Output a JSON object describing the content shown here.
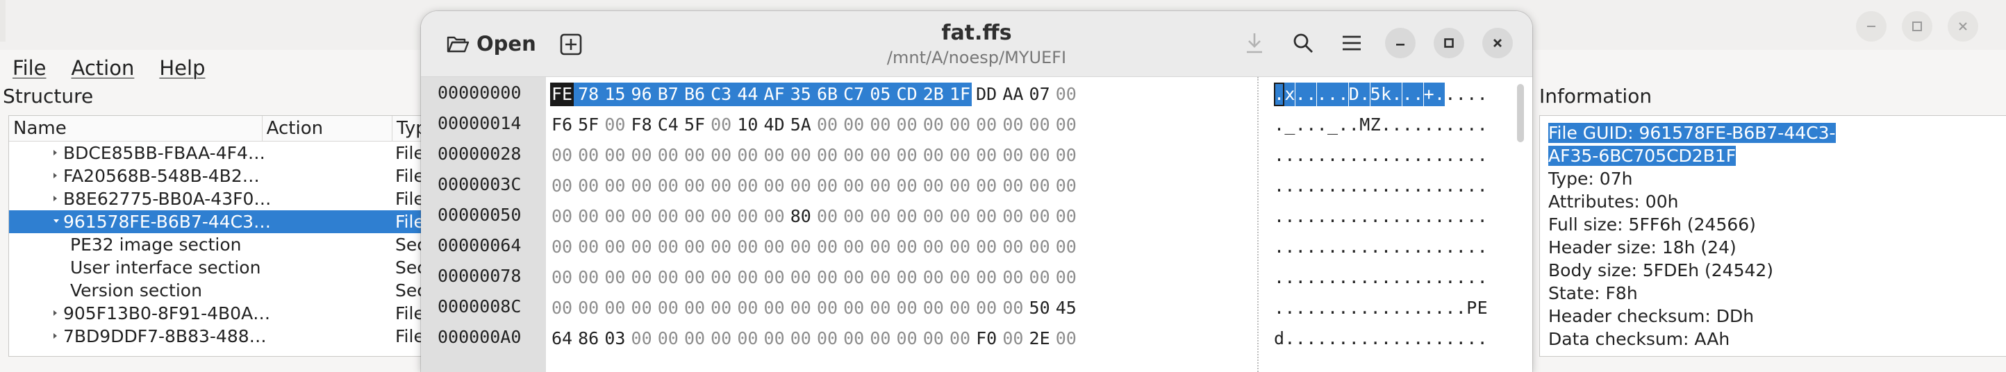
{
  "background_app": {
    "menu": [
      "File",
      "Action",
      "Help"
    ],
    "structure_label": "Structure",
    "information_label": "Information",
    "tree_columns": [
      "Name",
      "Action",
      "Type"
    ],
    "tree_rows": [
      {
        "name": "BDCE85BB-FBAA-4F4…",
        "type": "File",
        "indent": 1,
        "arrow": "right",
        "selected": false
      },
      {
        "name": "FA20568B-548B-4B2…",
        "type": "File",
        "indent": 1,
        "arrow": "right",
        "selected": false
      },
      {
        "name": "B8E62775-BB0A-43F0…",
        "type": "File",
        "indent": 1,
        "arrow": "right",
        "selected": false
      },
      {
        "name": "961578FE-B6B7-44C3…",
        "type": "File",
        "indent": 1,
        "arrow": "down",
        "selected": true
      },
      {
        "name": "PE32 image section",
        "type": "Sec",
        "indent": 2,
        "arrow": "none",
        "selected": false
      },
      {
        "name": "User interface section",
        "type": "Sec",
        "indent": 2,
        "arrow": "none",
        "selected": false
      },
      {
        "name": "Version section",
        "type": "Sec",
        "indent": 2,
        "arrow": "none",
        "selected": false
      },
      {
        "name": "905F13B0-8F91-4B0A…",
        "type": "File",
        "indent": 1,
        "arrow": "right",
        "selected": false
      },
      {
        "name": "7BD9DDF7-8B83-488…",
        "type": "File",
        "indent": 1,
        "arrow": "right",
        "selected": false
      }
    ],
    "info_lines": [
      {
        "text": "File GUID: 961578FE-B6B7-44C3-",
        "highlight": true
      },
      {
        "text": "AF35-6BC705CD2B1F",
        "highlight": true
      },
      {
        "text": "Type: 07h",
        "highlight": false
      },
      {
        "text": "Attributes: 00h",
        "highlight": false
      },
      {
        "text": "Full size: 5FF6h (24566)",
        "highlight": false
      },
      {
        "text": "Header size: 18h (24)",
        "highlight": false
      },
      {
        "text": "Body size: 5FDEh (24542)",
        "highlight": false
      },
      {
        "text": "State: F8h",
        "highlight": false
      },
      {
        "text": "Header checksum: DDh",
        "highlight": false
      },
      {
        "text": "Data checksum: AAh",
        "highlight": false
      }
    ]
  },
  "hex_editor": {
    "open_label": "Open",
    "title": "fat.ffs",
    "subtitle": "/mnt/A/noesp/MYUEFI",
    "icons": {
      "open": "folder-open-icon",
      "new": "plus-square-icon",
      "save": "download-icon",
      "search": "search-icon",
      "menu": "hamburger-menu-icon",
      "minimize": "minimize-icon",
      "maximize": "maximize-icon",
      "close": "close-icon"
    },
    "selection_color": "#2f7fd1",
    "selected_byte_count": 16,
    "rows": [
      {
        "addr": "00000000",
        "bytes": [
          "FE",
          "78",
          "15",
          "96",
          "B7",
          "B6",
          "C3",
          "44",
          "AF",
          "35",
          "6B",
          "C7",
          "05",
          "CD",
          "2B",
          "1F",
          "DD",
          "AA",
          "07",
          "00"
        ],
        "ascii": ".x.....D.5k...+....."
      },
      {
        "addr": "00000014",
        "bytes": [
          "F6",
          "5F",
          "00",
          "F8",
          "C4",
          "5F",
          "00",
          "10",
          "4D",
          "5A",
          "00",
          "00",
          "00",
          "00",
          "00",
          "00",
          "00",
          "00",
          "00",
          "00"
        ],
        "ascii": "._..._..MZ.........."
      },
      {
        "addr": "00000028",
        "bytes": [
          "00",
          "00",
          "00",
          "00",
          "00",
          "00",
          "00",
          "00",
          "00",
          "00",
          "00",
          "00",
          "00",
          "00",
          "00",
          "00",
          "00",
          "00",
          "00",
          "00"
        ],
        "ascii": "...................."
      },
      {
        "addr": "0000003C",
        "bytes": [
          "00",
          "00",
          "00",
          "00",
          "00",
          "00",
          "00",
          "00",
          "00",
          "00",
          "00",
          "00",
          "00",
          "00",
          "00",
          "00",
          "00",
          "00",
          "00",
          "00"
        ],
        "ascii": "...................."
      },
      {
        "addr": "00000050",
        "bytes": [
          "00",
          "00",
          "00",
          "00",
          "00",
          "00",
          "00",
          "00",
          "00",
          "80",
          "00",
          "00",
          "00",
          "00",
          "00",
          "00",
          "00",
          "00",
          "00",
          "00"
        ],
        "ascii": "...................."
      },
      {
        "addr": "00000064",
        "bytes": [
          "00",
          "00",
          "00",
          "00",
          "00",
          "00",
          "00",
          "00",
          "00",
          "00",
          "00",
          "00",
          "00",
          "00",
          "00",
          "00",
          "00",
          "00",
          "00",
          "00"
        ],
        "ascii": "...................."
      },
      {
        "addr": "00000078",
        "bytes": [
          "00",
          "00",
          "00",
          "00",
          "00",
          "00",
          "00",
          "00",
          "00",
          "00",
          "00",
          "00",
          "00",
          "00",
          "00",
          "00",
          "00",
          "00",
          "00",
          "00"
        ],
        "ascii": "...................."
      },
      {
        "addr": "0000008C",
        "bytes": [
          "00",
          "00",
          "00",
          "00",
          "00",
          "00",
          "00",
          "00",
          "00",
          "00",
          "00",
          "00",
          "00",
          "00",
          "00",
          "00",
          "00",
          "00",
          "50",
          "45"
        ],
        "ascii": "..................PE"
      },
      {
        "addr": "000000A0",
        "bytes": [
          "64",
          "86",
          "03",
          "00",
          "00",
          "00",
          "00",
          "00",
          "00",
          "00",
          "00",
          "00",
          "00",
          "00",
          "00",
          "00",
          "F0",
          "00",
          "2E",
          "00"
        ],
        "ascii": "d..................."
      }
    ]
  }
}
